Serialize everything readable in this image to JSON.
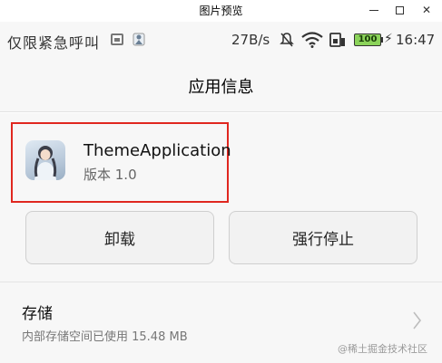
{
  "window": {
    "title": "图片预览",
    "min_glyph": "",
    "close_glyph": "✕"
  },
  "statusbar": {
    "left_text": "仅限紧急呼叫",
    "speed": "27B/s",
    "battery": "100",
    "bolt": "⚡",
    "time": "16:47"
  },
  "header": {
    "title": "应用信息"
  },
  "app": {
    "name": "ThemeApplication",
    "version": "版本 1.0"
  },
  "actions": {
    "uninstall": "卸载",
    "force_stop": "强行停止"
  },
  "storage": {
    "title": "存储",
    "subtitle": "内部存储空间已使用 15.48 MB"
  },
  "watermark": "@稀土掘金技术社区",
  "colors": {
    "highlight_border": "#e0271f",
    "battery_fill": "#8bd35a",
    "background": "#f7f7f7"
  }
}
